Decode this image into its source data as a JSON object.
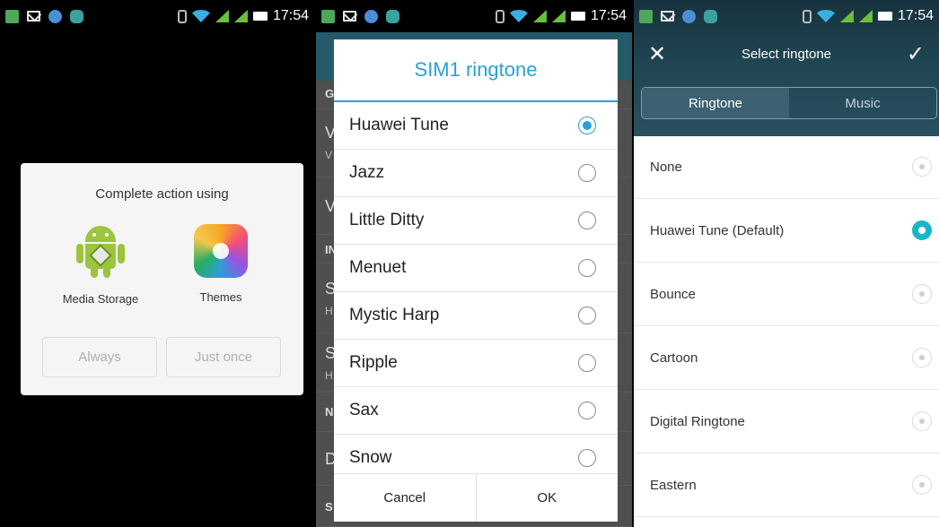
{
  "status_bar": {
    "time": "17:54"
  },
  "chooser": {
    "title": "Complete action using",
    "apps": [
      {
        "label": "Media Storage",
        "icon": "android-icon"
      },
      {
        "label": "Themes",
        "icon": "themes-icon"
      }
    ],
    "always_label": "Always",
    "just_once_label": "Just once"
  },
  "background_letters": [
    "G",
    "V",
    "V",
    "V",
    "IN",
    "S",
    "H",
    "S",
    "H",
    "N",
    "D",
    "S"
  ],
  "ringtone_dialog": {
    "title": "SIM1 ringtone",
    "items": [
      {
        "label": "Huawei Tune",
        "selected": true
      },
      {
        "label": "Jazz",
        "selected": false
      },
      {
        "label": "Little Ditty",
        "selected": false
      },
      {
        "label": "Menuet",
        "selected": false
      },
      {
        "label": "Mystic Harp",
        "selected": false
      },
      {
        "label": "Ripple",
        "selected": false
      },
      {
        "label": "Sax",
        "selected": false
      },
      {
        "label": "Snow",
        "selected": false
      }
    ],
    "cancel_label": "Cancel",
    "ok_label": "OK",
    "accent": "#2aa0d8"
  },
  "select_ringtone": {
    "title": "Select ringtone",
    "close_icon": "close-icon",
    "confirm_icon": "check-icon",
    "tabs": [
      {
        "label": "Ringtone",
        "active": true
      },
      {
        "label": "Music",
        "active": false
      }
    ],
    "items": [
      {
        "label": "None",
        "selected": false
      },
      {
        "label": "Huawei Tune (Default)",
        "selected": true
      },
      {
        "label": "Bounce",
        "selected": false
      },
      {
        "label": "Cartoon",
        "selected": false
      },
      {
        "label": "Digital Ringtone",
        "selected": false
      },
      {
        "label": "Eastern",
        "selected": false
      }
    ],
    "accent": "#19b6c9"
  }
}
